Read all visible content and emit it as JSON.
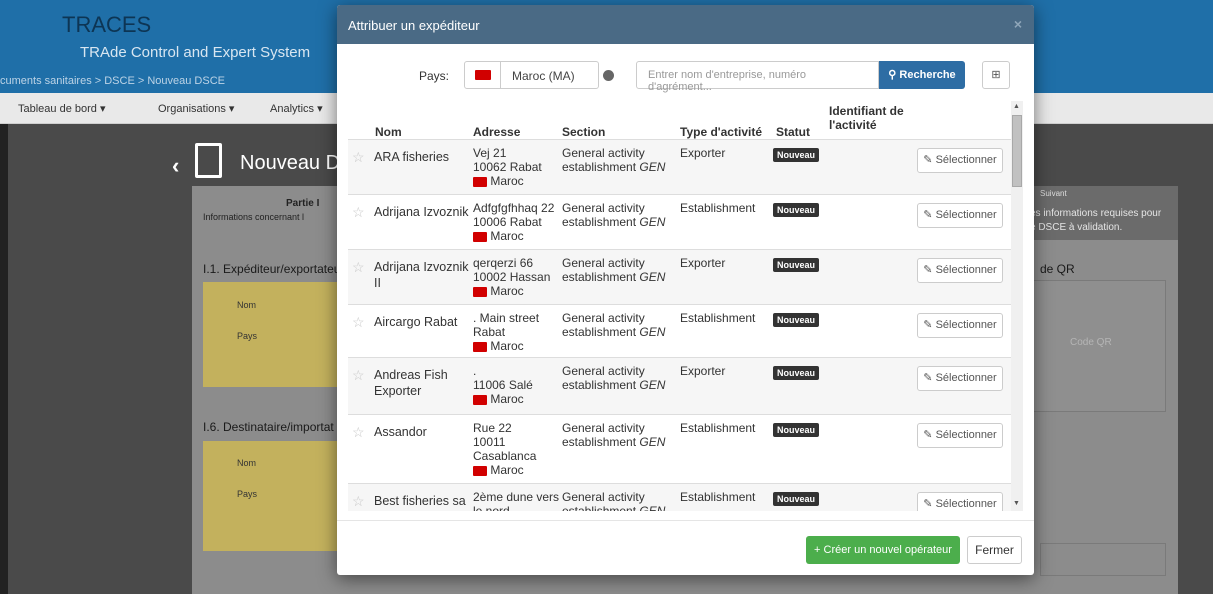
{
  "background": {
    "app_title": "TRACES",
    "app_subtitle": "TRAde Control and Expert System",
    "breadcrumb": "cuments sanitaires > DSCE > Nouveau DSCE",
    "nav": [
      "Tableau de bord ▾",
      "Organisations ▾",
      "Analytics ▾"
    ],
    "page_title": "Nouveau D",
    "partie": "Partie I",
    "partie_info": "Informations concernant l",
    "sec1": "I.1. Expéditeur/exportateur",
    "sec6": "I.6. Destinataire/importat",
    "nom": "Nom",
    "pays": "Pays",
    "suivant": "Suivant",
    "suivant_line1": "es informations requises pour",
    "suivant_line2": "e DSCE à validation.",
    "qr_label": "de QR",
    "qr_text": "Code QR"
  },
  "modal": {
    "title": "Attribuer un expéditeur",
    "close": "×",
    "pays_label": "Pays:",
    "pays_value": "Maroc (MA)",
    "search_placeholder": "Entrer nom d'entreprise, numéro d'agrément...",
    "search_button": "Recherche",
    "columns": [
      "Nom",
      "Adresse",
      "Section",
      "Type d'activité",
      "Statut",
      "Identifiant de",
      "l'activité"
    ],
    "rows": [
      {
        "nom": [
          "ARA fisheries"
        ],
        "adresse": [
          "Vej 21",
          "10062 Rabat"
        ],
        "pays": "Maroc",
        "section1": "General activity",
        "section2": "establishment ",
        "section_code": "GEN",
        "type": "Exporter",
        "statut": "Nouveau",
        "select": "Sélectionner"
      },
      {
        "nom": [
          "Adrijana Izvoznik"
        ],
        "adresse": [
          "Adfgfgfhhaq 22",
          "10006 Rabat"
        ],
        "pays": "Maroc",
        "section1": "General activity",
        "section2": "establishment ",
        "section_code": "GEN",
        "type": "Establishment",
        "statut": "Nouveau",
        "select": "Sélectionner"
      },
      {
        "nom": [
          "Adrijana Izvoznik",
          "II"
        ],
        "adresse": [
          "qerqerzi 66",
          "10002 Hassan"
        ],
        "pays": "Maroc",
        "section1": "General activity",
        "section2": "establishment ",
        "section_code": "GEN",
        "type": "Exporter",
        "statut": "Nouveau",
        "select": "Sélectionner"
      },
      {
        "nom": [
          "Aircargo Rabat"
        ],
        "adresse": [
          ". Main street",
          "Rabat"
        ],
        "pays": "Maroc",
        "section1": "General activity",
        "section2": "establishment ",
        "section_code": "GEN",
        "type": "Establishment",
        "statut": "Nouveau",
        "select": "Sélectionner"
      },
      {
        "nom": [
          "Andreas Fish",
          "Exporter"
        ],
        "adresse": [
          ".",
          "11006 Salé"
        ],
        "pays": "Maroc",
        "section1": "General activity",
        "section2": "establishment ",
        "section_code": "GEN",
        "type": "Exporter",
        "statut": "Nouveau",
        "select": "Sélectionner"
      },
      {
        "nom": [
          "Assandor"
        ],
        "adresse": [
          "Rue 22",
          "10011",
          "Casablanca"
        ],
        "pays": "Maroc",
        "section1": "General activity",
        "section2": "establishment ",
        "section_code": "GEN",
        "type": "Establishment",
        "statut": "Nouveau",
        "select": "Sélectionner"
      },
      {
        "nom": [
          "Best fisheries sa"
        ],
        "adresse": [
          "2ème dune vers",
          "le nord"
        ],
        "pays": "",
        "section1": "General activity",
        "section2": "establishment ",
        "section_code": "GEN",
        "type": "Establishment",
        "statut": "Nouveau",
        "select": "Sélectionner"
      }
    ],
    "create_button": "Créer un nouvel opérateur",
    "close_button": "Fermer"
  },
  "colors": {
    "header": "#4a6a85",
    "primary": "#2e6da4",
    "success": "#4cae4c",
    "flag": "#d10000"
  }
}
